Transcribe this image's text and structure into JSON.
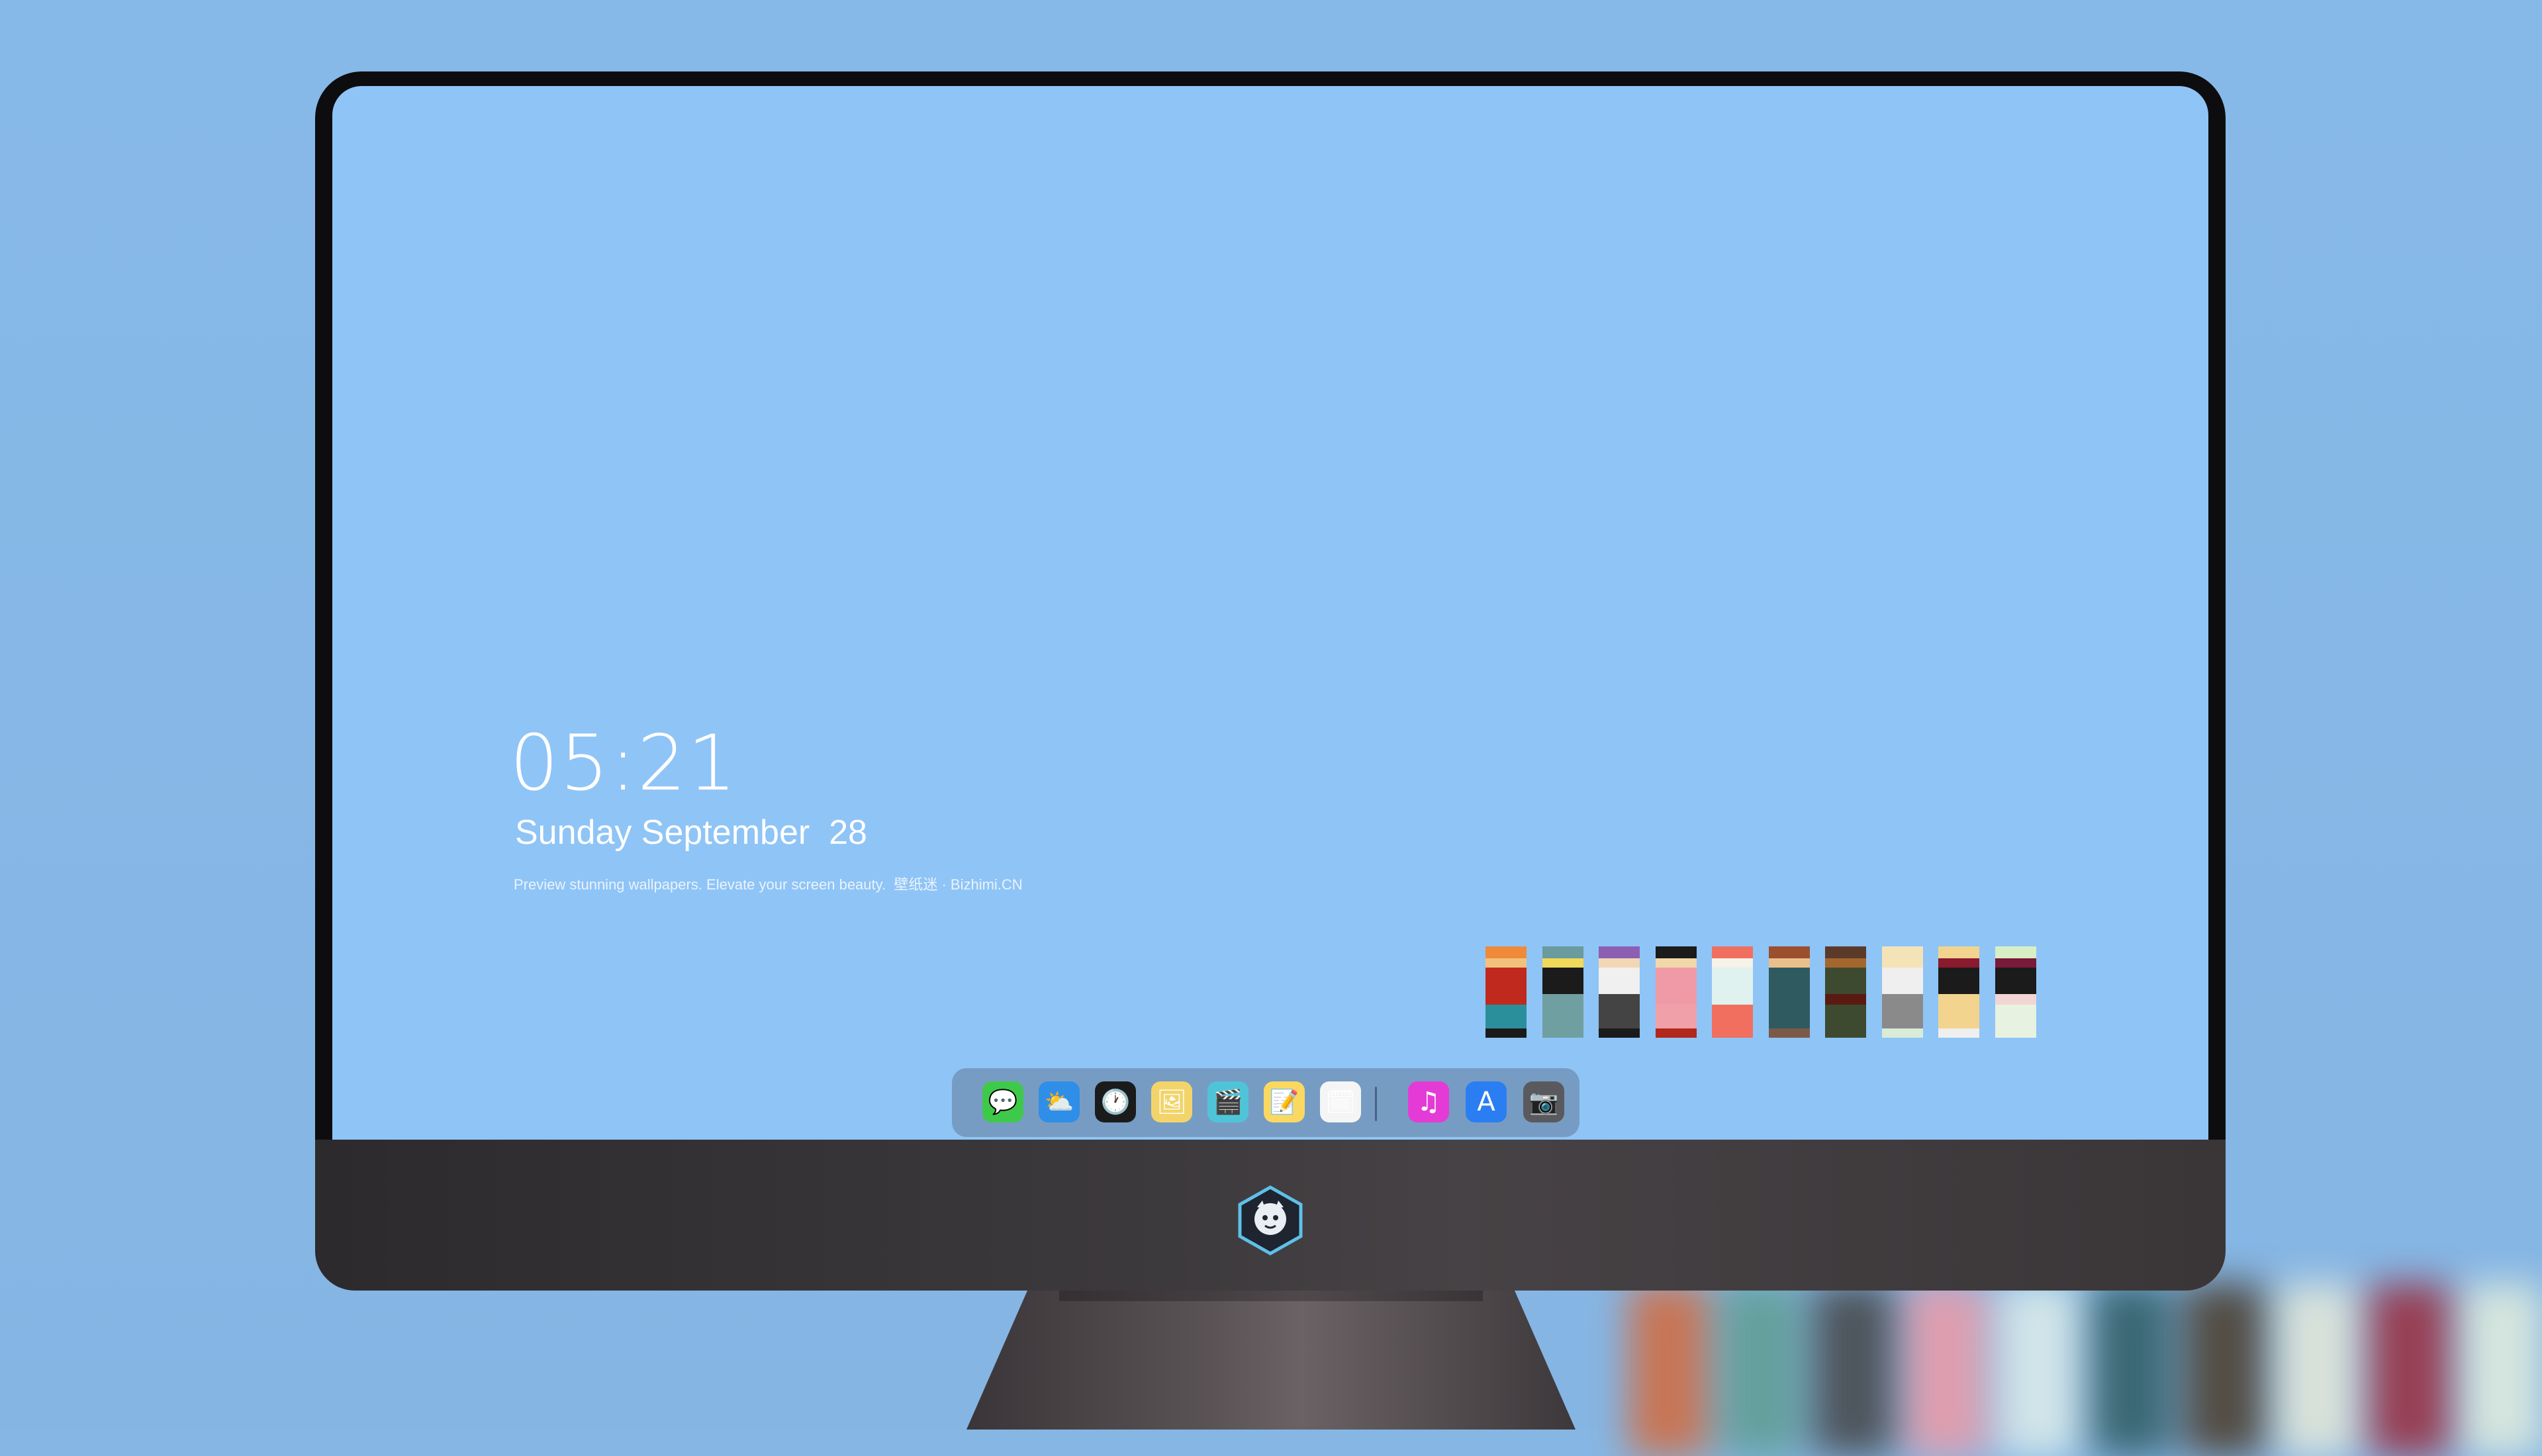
{
  "desktop": {
    "clock_time": "05:21",
    "date_text": "Sunday September  28",
    "tagline": "Preview stunning wallpapers. Elevate your screen beauty.  壁纸迷 · Bizhimi.CN"
  },
  "colors": {
    "backdrop": "#86b6e4",
    "screen": "#8fc4f6",
    "bezel": "#0d0d0f",
    "chin": "#3d3a3d",
    "dock": "#6e8caf"
  },
  "shelf": {
    "books": [
      {
        "name": "book-1",
        "stripes": [
          "#ef8a3a",
          "#f2c27c",
          "#c0291e",
          "#c0291e",
          "#2b8f9b",
          "#1b1b1b"
        ]
      },
      {
        "name": "book-2",
        "stripes": [
          "#6a9b9e",
          "#f1d95a",
          "#1b1b1b",
          "#6f9fa1",
          "#6f9fa1",
          "#6f9fa1"
        ]
      },
      {
        "name": "book-3",
        "stripes": [
          "#8d5fb2",
          "#f2d7b4",
          "#f0f0f0",
          "#444444",
          "#444444",
          "#1b1b1b"
        ]
      },
      {
        "name": "book-4",
        "stripes": [
          "#1b1b1b",
          "#f1d8a8",
          "#f19aa7",
          "#f19aa7",
          "#f0a0a8",
          "#b1271c"
        ]
      },
      {
        "name": "book-5",
        "stripes": [
          "#f06f5e",
          "#f6f2e8",
          "#dff2ef",
          "#dff2ef",
          "#f06f5e",
          "#f06f5e"
        ]
      },
      {
        "name": "book-6",
        "stripes": [
          "#9b4f2e",
          "#e9c08c",
          "#2f5a60",
          "#2f5a60",
          "#2f5a60",
          "#7b5a4a"
        ]
      },
      {
        "name": "book-7",
        "stripes": [
          "#5b3a2a",
          "#a3672e",
          "#3d4a30",
          "#5a1a12",
          "#3d4a30",
          "#3d4a30"
        ]
      },
      {
        "name": "book-8",
        "stripes": [
          "#f5e3b8",
          "#f5e3b8",
          "#efefef",
          "#8a8a8a",
          "#8a8a8a",
          "#d8ecd8"
        ]
      },
      {
        "name": "book-9",
        "stripes": [
          "#f2d48e",
          "#8a1a2e",
          "#1b1b1b",
          "#f2d48e",
          "#f2d48e",
          "#efefef"
        ]
      },
      {
        "name": "book-10",
        "stripes": [
          "#d7efc4",
          "#7a1a3a",
          "#1b1b1b",
          "#f2d5d5",
          "#e8f2e0",
          "#e8f2e0"
        ]
      }
    ]
  },
  "dock": {
    "apps": [
      {
        "name": "messages-icon",
        "glyph": "💬",
        "bg": "#3fc94a"
      },
      {
        "name": "weather-icon",
        "glyph": "⛅",
        "bg": "#2f8ee8"
      },
      {
        "name": "clock-icon",
        "glyph": "🕐",
        "bg": "#1b1b1b"
      },
      {
        "name": "preview-icon",
        "glyph": "🖼",
        "bg": "#f2d46a"
      },
      {
        "name": "clips-icon",
        "glyph": "🎬",
        "bg": "#4fc4d8"
      },
      {
        "name": "notes-icon",
        "glyph": "📝",
        "bg": "#fbd860"
      },
      {
        "name": "photo-booth-icon",
        "glyph": "🗓",
        "bg": "#f5f5f5"
      },
      {
        "name": "itunes-icon",
        "glyph": "♫",
        "bg": "#e43bd6"
      },
      {
        "name": "app-store-icon",
        "glyph": "A",
        "bg": "#2a7ef2"
      },
      {
        "name": "camera-icon",
        "glyph": "📷",
        "bg": "#5a5a5e"
      }
    ]
  }
}
